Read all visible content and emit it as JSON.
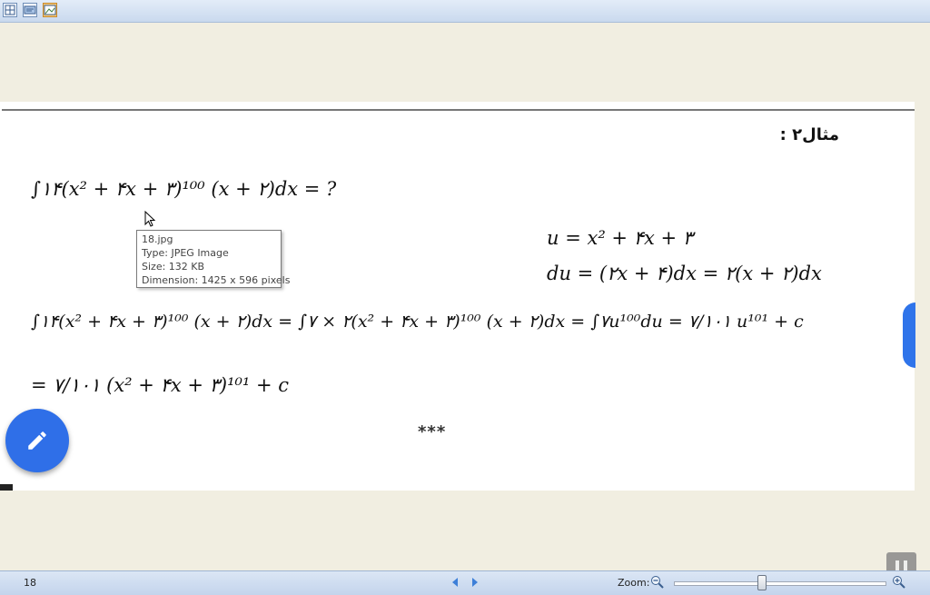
{
  "toolbar": {
    "buttons": [
      {
        "name": "grid-view-icon"
      },
      {
        "name": "slideshow-icon"
      },
      {
        "name": "image-view-icon",
        "active": true
      }
    ]
  },
  "document": {
    "heading": "مثال۲ :",
    "eq_question": "∫۱۴(x² + ۴x + ۳)¹⁰⁰ (x + ۲)dx = ?",
    "eq_u": "u = x² + ۴x + ۳",
    "eq_du": "du = (۲x + ۴)dx = ۲(x + ۲)dx",
    "eq_solution": "∫۱۴(x² + ۴x + ۳)¹⁰⁰ (x + ۲)dx = ∫۷ × ۲(x² + ۴x + ۳)¹⁰⁰ (x + ۲)dx = ∫۷u¹⁰⁰du = ۷/۱۰۱ u¹⁰¹ + c",
    "eq_result": "= ۷/۱۰۱ (x² + ۴x + ۳)¹⁰¹ + c",
    "stars": "***"
  },
  "tooltip": {
    "filename": "18.jpg",
    "type": "Type: JPEG Image",
    "size": "Size: 132 KB",
    "dimension": "Dimension: 1425 x 596 pixels"
  },
  "status": {
    "page_number": "18",
    "zoom_label": "Zoom:"
  },
  "colors": {
    "accent": "#2f6fe8",
    "toolbar": "#c9d9ee",
    "background": "#f1eee1"
  }
}
